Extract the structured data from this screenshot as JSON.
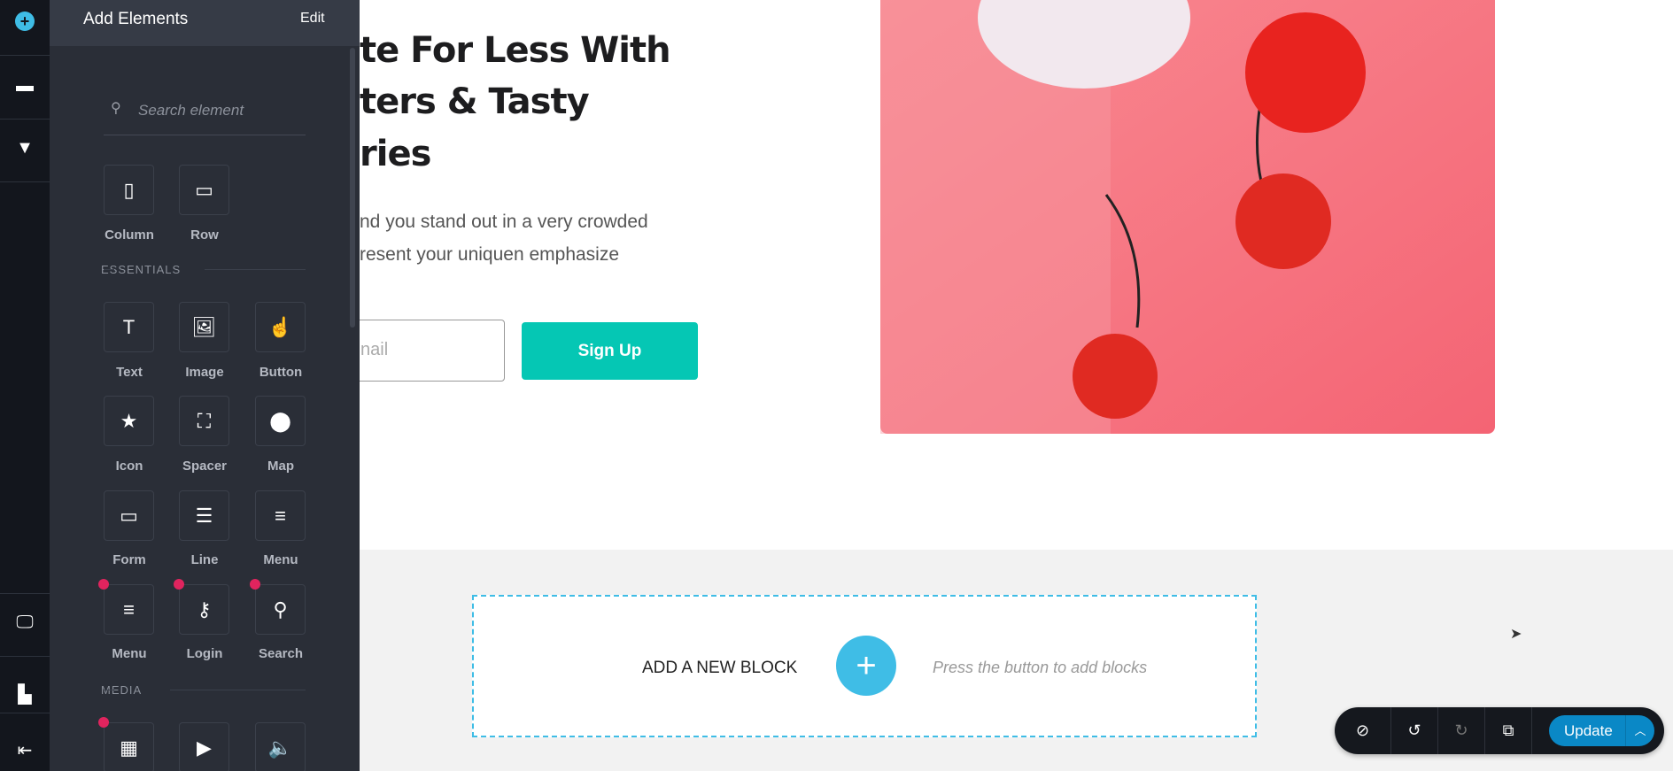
{
  "sidebar_strip": {
    "icons": [
      "add-circle-icon",
      "layout-icon",
      "paint-roller-icon",
      "desktop-icon",
      "page-icon",
      "exit-icon"
    ]
  },
  "panel": {
    "title": "Add Elements",
    "edit_label": "Edit",
    "search_placeholder": "Search element",
    "layout_items": [
      {
        "label": "Column",
        "icon": "column-icon"
      },
      {
        "label": "Row",
        "icon": "row-icon"
      }
    ],
    "sections": {
      "essentials": "ESSENTIALS",
      "media": "MEDIA"
    },
    "essentials": [
      {
        "label": "Text",
        "icon": "text-icon",
        "glyph": "T",
        "badge": false
      },
      {
        "label": "Image",
        "icon": "image-icon",
        "glyph": "🖼",
        "badge": false
      },
      {
        "label": "Button",
        "icon": "hand-pointer-icon",
        "glyph": "☝",
        "badge": false
      },
      {
        "label": "Icon",
        "icon": "star-icon",
        "glyph": "★",
        "badge": false
      },
      {
        "label": "Spacer",
        "icon": "expand-icon",
        "glyph": "⛶",
        "badge": false
      },
      {
        "label": "Map",
        "icon": "map-pin-icon",
        "glyph": "⬤",
        "badge": false
      },
      {
        "label": "Form",
        "icon": "form-icon",
        "glyph": "▭",
        "badge": false
      },
      {
        "label": "Line",
        "icon": "line-icon",
        "glyph": "☰",
        "badge": false
      },
      {
        "label": "Menu",
        "icon": "menu-icon",
        "glyph": "≡",
        "badge": false
      },
      {
        "label": "Menu",
        "icon": "menu-icon",
        "glyph": "≡",
        "badge": true
      },
      {
        "label": "Login",
        "icon": "key-icon",
        "glyph": "⚷",
        "badge": true
      },
      {
        "label": "Search",
        "icon": "search-icon",
        "glyph": "⚲",
        "badge": true
      }
    ],
    "media": [
      {
        "icon": "gallery-icon",
        "glyph": "▦",
        "badge": true
      },
      {
        "icon": "play-icon",
        "glyph": "▶",
        "badge": false
      },
      {
        "icon": "audio-icon",
        "glyph": "🔈",
        "badge": false
      }
    ]
  },
  "hero": {
    "heading_lines": [
      "te For Less With",
      "ters & Tasty",
      "ries"
    ],
    "paragraph_lines": [
      "nd you stand out in a very crowded",
      "resent your uniquen emphasize"
    ],
    "email_placeholder": "nail",
    "signup_label": "Sign Up"
  },
  "add_block": {
    "title": "ADD A NEW BLOCK",
    "hint": "Press the button to add blocks"
  },
  "toolbar": {
    "update_label": "Update",
    "icons": [
      "hide-icon",
      "undo-icon",
      "redo-icon",
      "external-link-icon",
      "chevron-up-icon"
    ]
  },
  "colors": {
    "accent": "#3fbde6",
    "signup": "#05c7b4",
    "update": "#0a88c6",
    "badge": "#e0245e"
  }
}
